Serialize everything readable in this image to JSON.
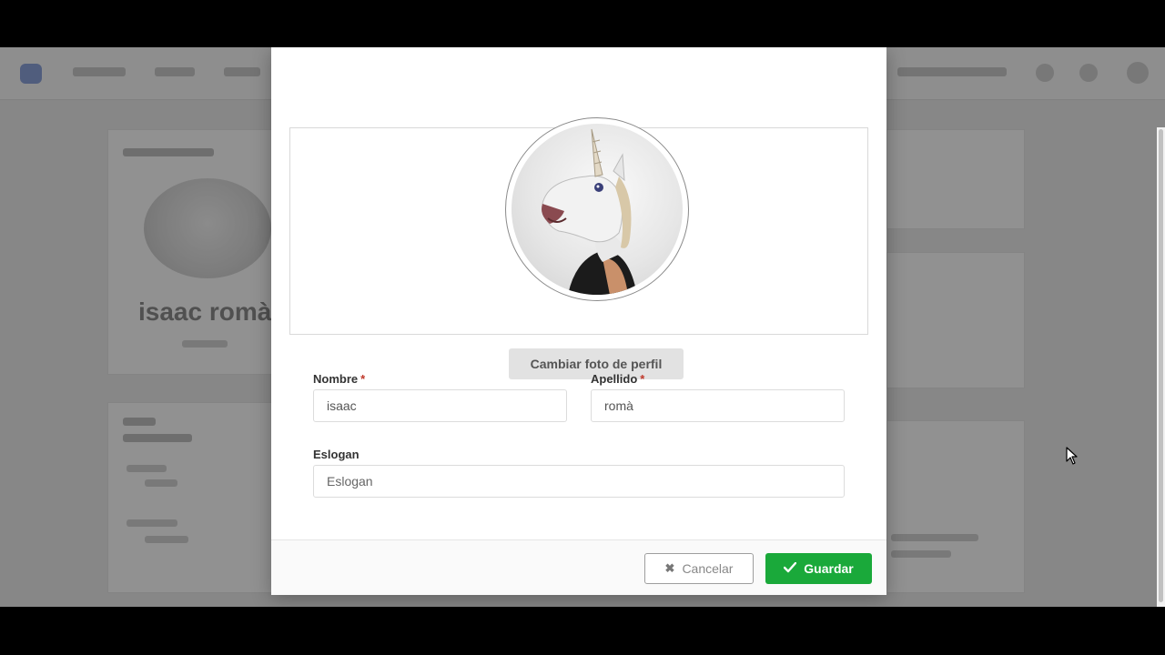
{
  "modal": {
    "change_photo_label": "Cambiar foto de perfil",
    "first_name": {
      "label": "Nombre",
      "required_mark": "*",
      "value": "isaac"
    },
    "last_name": {
      "label": "Apellido",
      "required_mark": "*",
      "value": "romà"
    },
    "slogan": {
      "label": "Eslogan",
      "placeholder": "Eslogan",
      "value": ""
    },
    "cancel_label": "Cancelar",
    "save_label": "Guardar"
  },
  "background": {
    "profile_name": "isaac romà"
  },
  "colors": {
    "save_button": "#1aa93a",
    "required": "#c0392b"
  },
  "icons": {
    "cancel": "close-icon",
    "save": "check-icon"
  }
}
